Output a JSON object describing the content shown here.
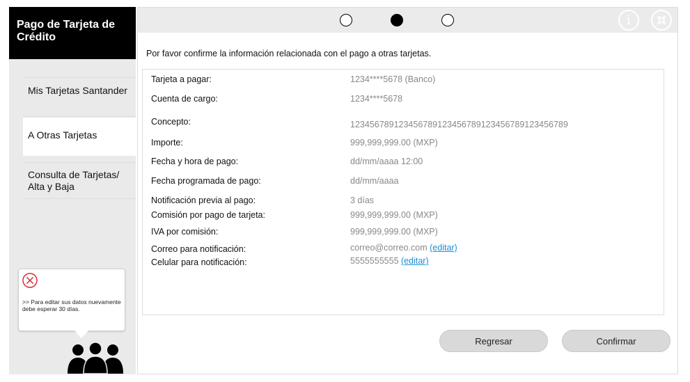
{
  "sidebar": {
    "title": "Pago de Tarjeta de Crédito",
    "items": [
      {
        "label": "Mis Tarjetas Santander"
      },
      {
        "label": "A Otras Tarjetas"
      },
      {
        "label": "Consulta de Tarjetas/ Alta y Baja"
      }
    ],
    "warning": {
      "text": ">> Para editar sus datos nuevamente debe esperar 30 días.",
      "icon": "close-circle-icon"
    }
  },
  "stepper": {
    "steps": [
      "step-1",
      "step-2",
      "step-3"
    ],
    "active_step": 2
  },
  "header_icons": [
    "info-icon",
    "collapse-icon"
  ],
  "main": {
    "intro": "Por favor  confirme la información relacionada con el pago a otras tarjetas.",
    "fields": [
      {
        "label": "Tarjeta a pagar:",
        "value": "1234****5678 (Banco)"
      },
      {
        "label": "Cuenta de cargo:",
        "value": "1234****5678"
      },
      {
        "label": "Concepto:",
        "value": "123456789123456789123456789123456789123456789"
      },
      {
        "label": "Importe:",
        "value": "999,999,999.00 (MXP)"
      },
      {
        "label": "Fecha y hora de pago:",
        "value": "dd/mm/aaaa 12:00"
      },
      {
        "label": "Fecha programada de pago:",
        "value": "dd/mm/aaaa"
      },
      {
        "label": "Notificación previa al pago:",
        "value": "3 días"
      },
      {
        "label": "Comisión por pago de tarjeta:",
        "value": "999,999,999.00 (MXP)"
      },
      {
        "label": "IVA por comisión:",
        "value": "999,999,999.00 (MXP)"
      },
      {
        "label": "Correo para notificación:",
        "value": "correo@correo.com",
        "link": "(editar)"
      },
      {
        "label": "Celular para notificación:",
        "value": "5555555555",
        "link": "(editar)"
      }
    ]
  },
  "buttons": {
    "back": "Regresar",
    "confirm": "Confirmar"
  },
  "colors": {
    "sidebar_bg": "#eaeaea",
    "title_bg": "#000000",
    "link": "#1a8fd6",
    "value_text": "#888888"
  }
}
